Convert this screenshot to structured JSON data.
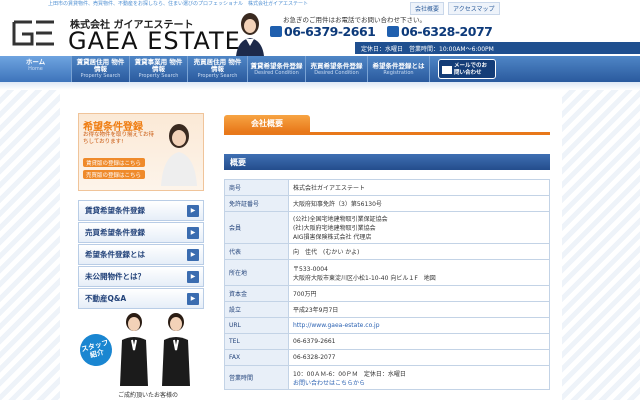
{
  "header": {
    "tagline": "上田市の賃貸物件、売買物件、不動産をお探しなら、住まい選びのプロフェッショナル　株式会社ガイアエステート",
    "company_prefix": "株式会社 ガイアエステート",
    "logo_text": "GAEA ESTATE",
    "links": [
      "会社概要",
      "アクセスマップ"
    ],
    "phone_note": "お急ぎのご用件はお電話でお問い合わせ下さい。",
    "phone1": "06-6379-2661",
    "phone2": "06-6328-2077",
    "hours": "定休日：水曜日　営業時間：10:00AM～6:00PM"
  },
  "nav": [
    {
      "main": "ホーム",
      "sub": "Home"
    },
    {
      "main": "賃貸居住用 物件情報",
      "sub": "Property Search"
    },
    {
      "main": "賃貸事業用 物件情報",
      "sub": "Property Search"
    },
    {
      "main": "売買居住用 物件情報",
      "sub": "Property Search"
    },
    {
      "main": "賃貸希望条件登録",
      "sub": "Desired Condition"
    },
    {
      "main": "売買希望条件登録",
      "sub": "Desired Condition"
    },
    {
      "main": "希望条件登録とは",
      "sub": "Registration"
    },
    {
      "main": "メールでのお問い合わせ",
      "sub": ""
    }
  ],
  "sidebar": {
    "banner_title": "希望条件登録",
    "banner_text": "お得な物件を取り揃えてお待ちしております!",
    "banner_btn1": "賃貸版の登録はこちら",
    "banner_btn2": "売買版の登録はこちら",
    "menu": [
      "賃貸希望条件登録",
      "売買希望条件登録",
      "希望条件登録とは",
      "未公開物件とは？",
      "不動産Q&A"
    ],
    "staff_badge": "スタッフ紹介",
    "staff_caption": "ご成約頂いたお客様の"
  },
  "main": {
    "section_tab": "会社概要",
    "heading": "概要",
    "rows": [
      {
        "k": "商号",
        "v": [
          "株式会社ガイアエステート"
        ]
      },
      {
        "k": "免許証番号",
        "v": [
          "大阪府知事免許（3）第56130号"
        ]
      },
      {
        "k": "会員",
        "v": [
          "(公社)全国宅地建物取引業保証協会",
          "(社)大阪府宅地建物取引業協会",
          "AIG損害保険株式会社 代理店"
        ]
      },
      {
        "k": "代表",
        "v": [
          "向　佳代　(むかい かよ)"
        ]
      },
      {
        "k": "所在地",
        "v": [
          "〒533-0004",
          "大阪府大阪市東淀川区小松1-10-40 向ビル１F　地図"
        ]
      },
      {
        "k": "資本金",
        "v": [
          "700万円"
        ]
      },
      {
        "k": "設立",
        "v": [
          "平成23年9月7日"
        ]
      },
      {
        "k": "URL",
        "v": [
          "http://www.gaea-estate.co.jp"
        ]
      },
      {
        "k": "TEL",
        "v": [
          "06-6379-2661"
        ]
      },
      {
        "k": "FAX",
        "v": [
          "06-6328-2077"
        ]
      },
      {
        "k": "営業時間",
        "v": [
          "10：00ＡＭ-6：00ＰＭ　定休日：水曜日",
          "お問い合わせはこちらから"
        ]
      }
    ]
  },
  "colors": {
    "brand_blue": "#2a5a9e",
    "accent_orange": "#e8781a",
    "table_head": "#e8eff8"
  }
}
